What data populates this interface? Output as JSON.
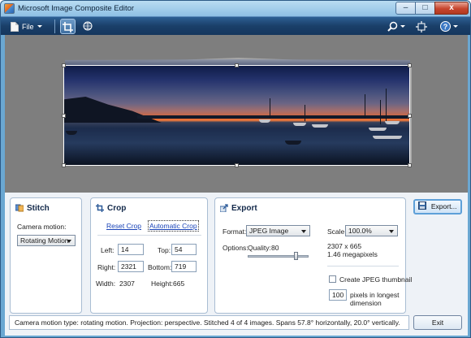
{
  "window": {
    "title": "Microsoft Image Composite Editor",
    "minimize": "–",
    "maximize": "□",
    "close": "x"
  },
  "toolbar": {
    "file_label": "File"
  },
  "stitch": {
    "title": "Stitch",
    "camera_motion_label": "Camera motion:",
    "camera_motion_value": "Rotating Motion"
  },
  "crop": {
    "title": "Crop",
    "reset_label": "Reset Crop",
    "auto_label": "Automatic Crop",
    "left_label": "Left:",
    "left": "14",
    "top_label": "Top:",
    "top": "54",
    "right_label": "Right:",
    "right": "2321",
    "bottom_label": "Bottom:",
    "bottom": "719",
    "width_label": "Width:",
    "width": "2307",
    "height_label": "Height:",
    "height": "665"
  },
  "export": {
    "title": "Export",
    "format_label": "Format:",
    "format_value": "JPEG Image",
    "options_label": "Options:",
    "quality_label": "Quality:",
    "quality": "80",
    "quality_fraction": 0.8,
    "scale_label": "Scale:",
    "scale_value": "100.0%",
    "dimensions": "2307 x 665",
    "megapixels": "1.46 megapixels",
    "thumbnail_label": "Create JPEG thumbnail",
    "thumbnail_checked": false,
    "pixels_value": "100",
    "pixels_label_1": "pixels in longest",
    "pixels_label_2": "dimension",
    "button_label": "Export..."
  },
  "status": {
    "text": "Camera motion type: rotating motion. Projection: perspective. Stitched 4 of 4 images. Spans 57.8° horizontally, 20.0° vertically."
  },
  "exit_label": "Exit"
}
